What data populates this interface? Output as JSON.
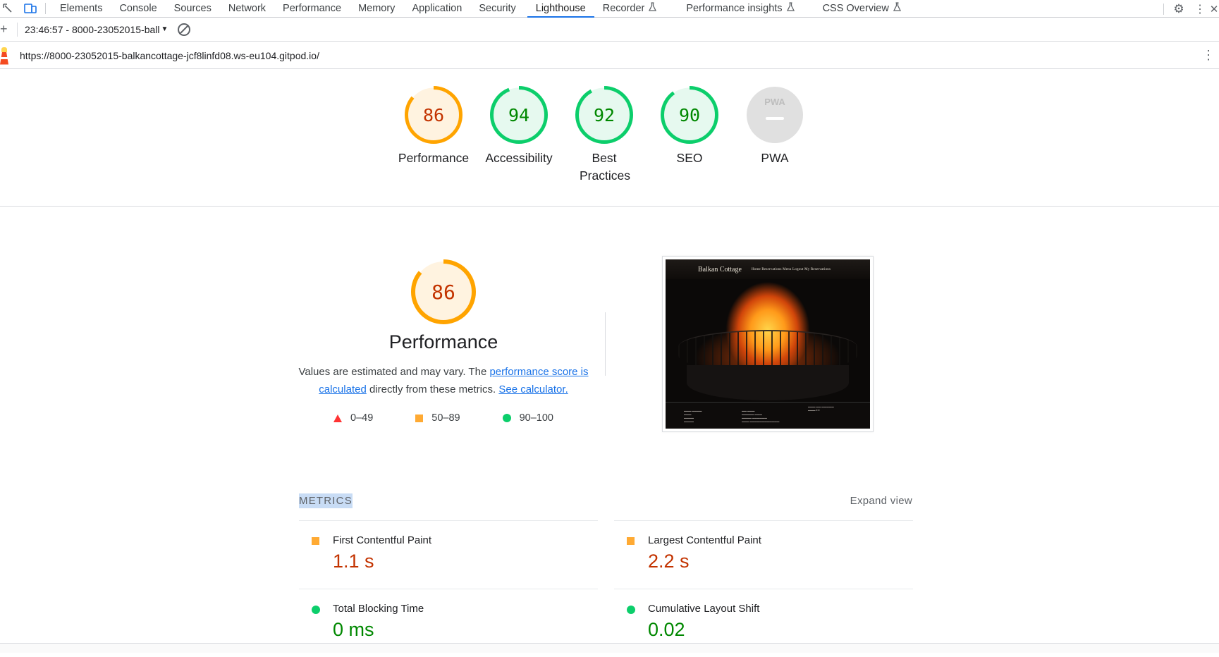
{
  "devtools": {
    "tabs": [
      {
        "label": "Elements"
      },
      {
        "label": "Console"
      },
      {
        "label": "Sources"
      },
      {
        "label": "Network"
      },
      {
        "label": "Performance"
      },
      {
        "label": "Memory"
      },
      {
        "label": "Application"
      },
      {
        "label": "Security"
      },
      {
        "label": "Lighthouse",
        "active": true
      },
      {
        "label": "Recorder",
        "experimental": true
      },
      {
        "label": "Performance insights",
        "experimental": true
      },
      {
        "label": "CSS Overview",
        "experimental": true
      }
    ],
    "report_select": "23:46:57 - 8000-23052015-ball",
    "url": "https://8000-23052015-balkancottage-jcf8linfd08.ws-eu104.gitpod.io/"
  },
  "scores": [
    {
      "label": "Performance",
      "score": "86",
      "level": "average"
    },
    {
      "label": "Accessibility",
      "score": "94",
      "level": "pass"
    },
    {
      "label": "Best Practices",
      "score": "92",
      "level": "pass"
    },
    {
      "label": "SEO",
      "score": "90",
      "level": "pass"
    },
    {
      "label": "PWA",
      "score": "",
      "level": "na",
      "badge": "PWA"
    }
  ],
  "performance": {
    "score": "86",
    "title": "Performance",
    "desc_prefix": "Values are estimated and may vary. The ",
    "desc_link1": "performance score is calculated",
    "desc_middle": " directly from these metrics. ",
    "desc_link2": "See calculator.",
    "legend": [
      {
        "range": "0–49",
        "shape": "triangle",
        "color": "#ff3333"
      },
      {
        "range": "50–89",
        "shape": "square",
        "color": "#ffaa33"
      },
      {
        "range": "90–100",
        "shape": "circle",
        "color": "#0cce6b"
      }
    ]
  },
  "screenshot": {
    "brand": "Balkan Cottage",
    "nav": "Home   Reservations   Menu   Logout   My Reservations"
  },
  "metrics": {
    "title": "METRICS",
    "expand": "Expand view",
    "items": [
      {
        "name": "First Contentful Paint",
        "value": "1.1 s",
        "level": "average"
      },
      {
        "name": "Largest Contentful Paint",
        "value": "2.2 s",
        "level": "average"
      },
      {
        "name": "Total Blocking Time",
        "value": "0 ms",
        "level": "pass"
      },
      {
        "name": "Cumulative Layout Shift",
        "value": "0.02",
        "level": "pass"
      }
    ]
  },
  "colors": {
    "average": "#ffa400",
    "average_text": "#c33300",
    "average_bg": "#fff3e0",
    "pass": "#0cce6b",
    "pass_text": "#008800",
    "pass_bg": "#e6f9ef",
    "na": "#e0e0e0",
    "accent": "#1a73e8"
  }
}
